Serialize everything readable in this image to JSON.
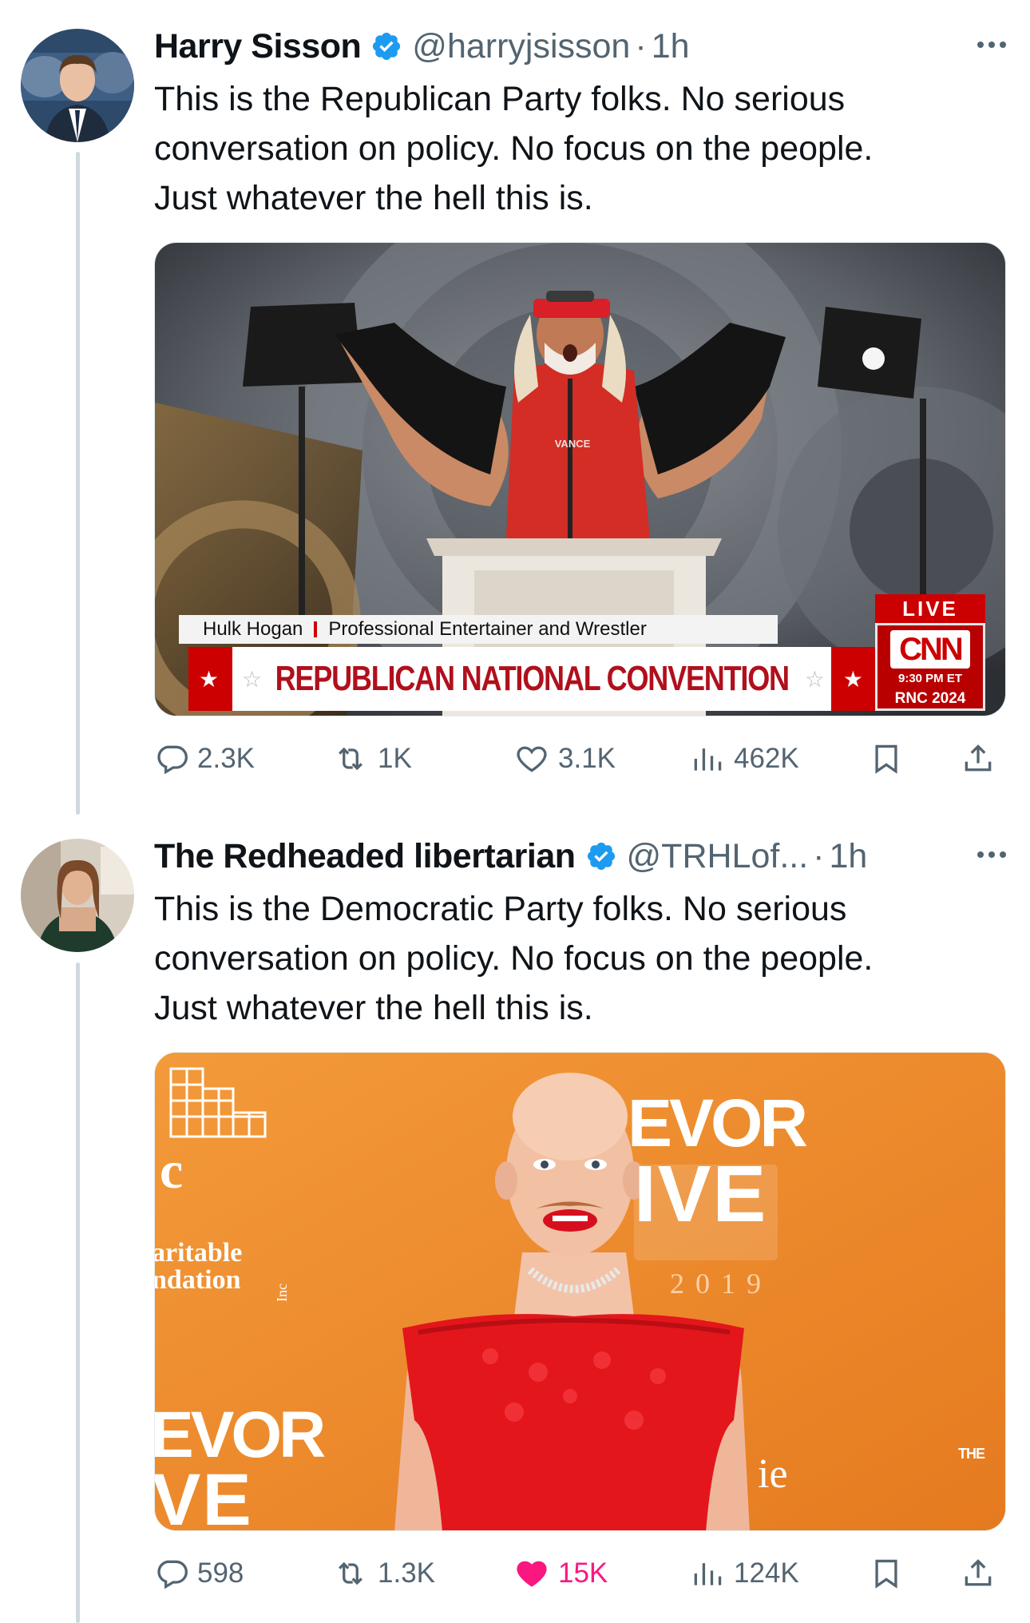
{
  "tweets": [
    {
      "name": "Harry Sisson",
      "handle": "@harryjsisson",
      "separator": "·",
      "time": "1h",
      "text": "This is the Republican Party folks. No serious\nconversation on policy. No focus on the people.\nJust whatever the hell this is.",
      "media": {
        "lower_third_name": "Hulk Hogan",
        "lower_third_title": "Professional Entertainer and Wrestler",
        "banner": "REPUBLICAN NATIONAL CONVENTION",
        "live_label": "LIVE",
        "network": "CNN",
        "clock": "9:30 PM ET",
        "event_tag": "RNC 2024",
        "shirt_text": "VANCE"
      },
      "stats": {
        "replies": "2.3K",
        "reposts": "1K",
        "likes": "3.1K",
        "views": "462K",
        "liked": false
      }
    },
    {
      "name": "The Redheaded libertarian",
      "handle": "@TRHLof...",
      "separator": "·",
      "time": "1h",
      "text": "This is the Democratic Party folks. No serious\nconversation on policy. No focus on the people.\nJust whatever the hell this is.",
      "media": {
        "backdrop_word_1": "EVOR",
        "backdrop_word_2": "IVE",
        "backdrop_year": "2019",
        "backdrop_c": "c",
        "backdrop_charitable": "aritable",
        "backdrop_foundation": "ndation",
        "backdrop_inc": "Inc",
        "backdrop_word_3": "EVOR",
        "backdrop_word_4": "VE",
        "backdrop_ie": "ie",
        "backdrop_the": "THE"
      },
      "stats": {
        "replies": "598",
        "reposts": "1.3K",
        "likes": "15K",
        "views": "124K",
        "liked": true
      }
    }
  ],
  "colors": {
    "text": "#0f1419",
    "secondary": "#536471",
    "verified": "#1d9bf0",
    "like_active": "#f91880",
    "thread_line": "#cfd9de",
    "cnn_red": "#cc0000",
    "orange_backdrop": "#f08a2c"
  },
  "icons": [
    "verified-badge-icon",
    "more-icon",
    "reply-icon",
    "repost-icon",
    "like-icon",
    "views-icon",
    "bookmark-icon",
    "share-icon"
  ]
}
